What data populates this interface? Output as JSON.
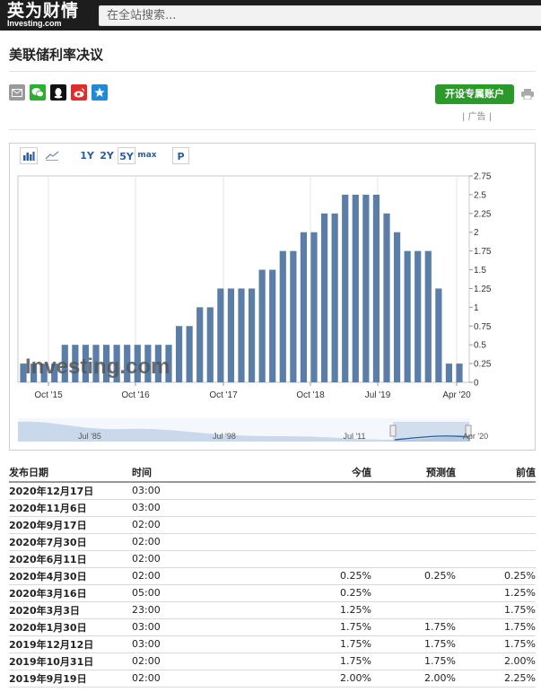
{
  "header": {
    "logo_cn": "英为财情",
    "logo_en": "Investing.com",
    "search_placeholder": "在全站搜索..."
  },
  "page_title": "美联储利率决议",
  "share_icons": [
    "mail-icon",
    "wechat-icon",
    "qq-icon",
    "weibo-icon",
    "qzone-icon"
  ],
  "cta": {
    "label": "开设专属账户",
    "ad_label": "| 广告 |"
  },
  "toolbar": {
    "ranges": [
      "1Y",
      "2Y",
      "5Y",
      "max"
    ],
    "selected": "5Y",
    "p_label": "P"
  },
  "chart_data": {
    "type": "bar",
    "watermark": "Investing.com",
    "y_ticks": [
      "0",
      "0.25",
      "0.5",
      "0.75",
      "1",
      "1.25",
      "1.5",
      "1.75",
      "2",
      "2.25",
      "2.5",
      "2.75"
    ],
    "ylim": [
      0,
      2.75
    ],
    "x_labels": [
      "Oct '15",
      "Oct '16",
      "Oct '17",
      "Oct '18",
      "Jul '19",
      "Apr '20"
    ],
    "values": [
      0.25,
      0.25,
      0.25,
      0.25,
      0.5,
      0.5,
      0.5,
      0.5,
      0.5,
      0.5,
      0.5,
      0.5,
      0.5,
      0.5,
      0.5,
      0.75,
      0.75,
      1.0,
      1.0,
      1.25,
      1.25,
      1.25,
      1.25,
      1.5,
      1.5,
      1.75,
      1.75,
      2.0,
      2.0,
      2.25,
      2.25,
      2.5,
      2.5,
      2.5,
      2.5,
      2.25,
      2.0,
      1.75,
      1.75,
      1.75,
      1.25,
      0.25,
      0.25
    ],
    "navigator_labels": [
      "Jul '85",
      "Jul '98",
      "Jul '11",
      "Apr '20"
    ]
  },
  "colors": {
    "bar": "#5b7ea8",
    "accent": "#2a5d9f",
    "cta": "#2b9a2b"
  },
  "table": {
    "headers": [
      "发布日期",
      "时间",
      "今值",
      "预测值",
      "前值"
    ],
    "rows": [
      [
        "2020年12月17日",
        "03:00",
        "",
        "",
        ""
      ],
      [
        "2020年11月6日",
        "03:00",
        "",
        "",
        ""
      ],
      [
        "2020年9月17日",
        "02:00",
        "",
        "",
        ""
      ],
      [
        "2020年7月30日",
        "02:00",
        "",
        "",
        ""
      ],
      [
        "2020年6月11日",
        "02:00",
        "",
        "",
        ""
      ],
      [
        "2020年4月30日",
        "02:00",
        "0.25%",
        "0.25%",
        "0.25%"
      ],
      [
        "2020年3月16日",
        "05:00",
        "0.25%",
        "",
        "1.25%"
      ],
      [
        "2020年3月3日",
        "23:00",
        "1.25%",
        "",
        "1.75%"
      ],
      [
        "2020年1月30日",
        "03:00",
        "1.75%",
        "1.75%",
        "1.75%"
      ],
      [
        "2019年12月12日",
        "03:00",
        "1.75%",
        "1.75%",
        "1.75%"
      ],
      [
        "2019年10月31日",
        "02:00",
        "1.75%",
        "1.75%",
        "2.00%"
      ],
      [
        "2019年9月19日",
        "02:00",
        "2.00%",
        "2.00%",
        "2.25%"
      ]
    ]
  }
}
